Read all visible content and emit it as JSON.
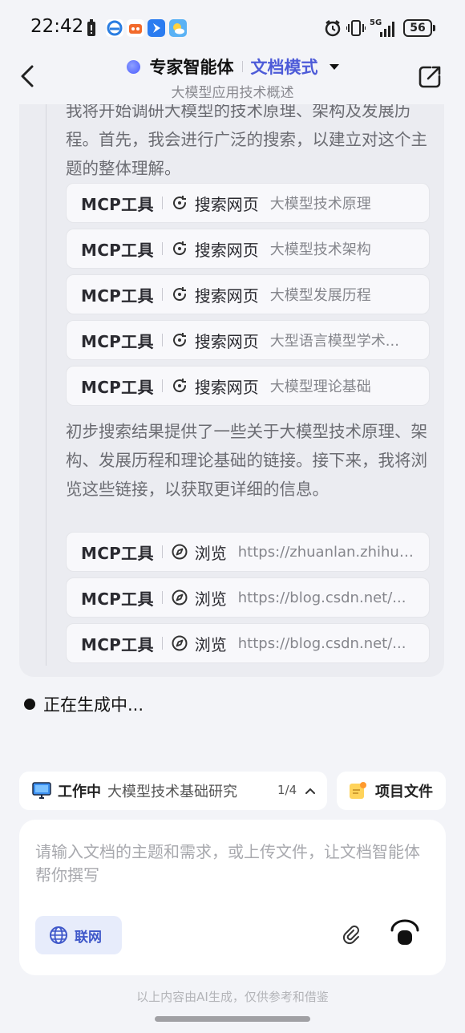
{
  "status_bar": {
    "time": "22:42",
    "network": "5G",
    "battery": "56"
  },
  "header": {
    "agent_name": "专家智能体",
    "mode": "文档模式",
    "subtitle": "大模型应用技术概述",
    "back_icon": "chevron-left-icon",
    "share_icon": "share-icon",
    "accent_color": "#4d5bd8"
  },
  "conversation": {
    "intro_text": "我将开始调研大模型的技术原理、架构及发展历程。首先，我会进行广泛的搜索，以建立对这个主题的整体理解。",
    "search_calls": [
      {
        "tool": "MCP工具",
        "action": "搜索网页",
        "query": "大模型技术原理"
      },
      {
        "tool": "MCP工具",
        "action": "搜索网页",
        "query": "大模型技术架构"
      },
      {
        "tool": "MCP工具",
        "action": "搜索网页",
        "query": "大模型发展历程"
      },
      {
        "tool": "MCP工具",
        "action": "搜索网页",
        "query": "大型语言模型学术..."
      },
      {
        "tool": "MCP工具",
        "action": "搜索网页",
        "query": "大模型理论基础"
      }
    ],
    "followup_text": "初步搜索结果提供了一些关于大模型技术原理、架构、发展历程和理论基础的链接。接下来，我将浏览这些链接，以获取更详细的信息。",
    "browse_calls": [
      {
        "tool": "MCP工具",
        "action": "浏览",
        "url": "https://zhuanlan.zhihu...."
      },
      {
        "tool": "MCP工具",
        "action": "浏览",
        "url": "https://blog.csdn.net/..."
      },
      {
        "tool": "MCP工具",
        "action": "浏览",
        "url": "https://blog.csdn.net/..."
      }
    ],
    "generating_text": "正在生成中..."
  },
  "task_bar": {
    "status": "工作中",
    "task_name": "大模型技术基础研究",
    "progress": "1/4",
    "files_label": "项目文件"
  },
  "composer": {
    "placeholder": "请输入文档的主题和需求，或上传文件，让文档智能体帮你撰写",
    "web_label": "联网"
  },
  "footer": {
    "disclaimer": "以上内容由AI生成，仅供参考和借鉴"
  }
}
